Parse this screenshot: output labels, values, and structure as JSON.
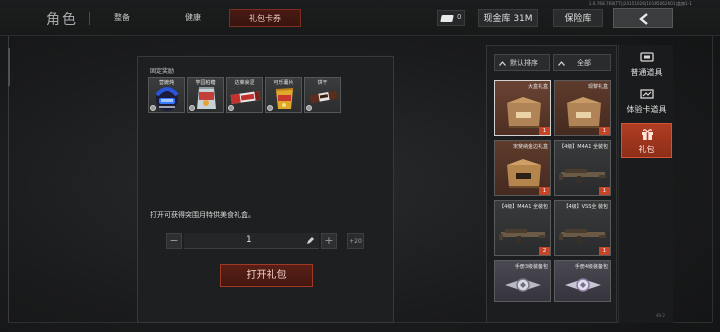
{
  "version": "1.0.768.768(TT)|20151026|10185062601|盖旗1-1",
  "page_title": "角色",
  "tabs": [
    {
      "label": "整备",
      "active": false
    },
    {
      "label": "健康",
      "active": false
    },
    {
      "label": "礼包卡券",
      "active": true
    }
  ],
  "header": {
    "ticket_count": "0",
    "cash_label": "现金库 31M",
    "warehouse_label": "保险库",
    "back_icon": "chevron-left-icon"
  },
  "center": {
    "fixed_rewards_label": "固定奖励",
    "rewards": [
      {
        "name": "营嬷炖",
        "icon": "helmet-icon"
      },
      {
        "name": "竽园柏糖",
        "icon": "candy-bag-icon"
      },
      {
        "name": "达莱哀涩",
        "icon": "candy-bar-icon"
      },
      {
        "name": "可乐薯片",
        "icon": "chips-bag-icon"
      },
      {
        "name": "饼干",
        "icon": "biscuit-icon"
      }
    ],
    "description": "打开可获得突围月特供美食礼盒。",
    "quantity": "1",
    "max_label": "+20",
    "open_button": "打开礼包"
  },
  "inventory": {
    "sort_label": "默认排序",
    "filter_label": "全部",
    "items": [
      {
        "name": "大盒礼盒",
        "count": "1",
        "style": "crate",
        "selected": true
      },
      {
        "name": "现黎礼盒",
        "count": "1",
        "style": "crate",
        "selected": false
      },
      {
        "name": "宋斐纳金边礼盒",
        "count": "1",
        "style": "crate",
        "selected": false
      },
      {
        "name": "【4级】M4A1 全装包",
        "count": "1",
        "style": "rifle",
        "selected": false
      },
      {
        "name": "【4级】M4A1 全装包",
        "count": "2",
        "style": "rifle",
        "selected": false
      },
      {
        "name": "【4级】VSS全 装包",
        "count": "1",
        "style": "rifle",
        "selected": false
      },
      {
        "name": "手册3级装备包",
        "count": "",
        "style": "badge",
        "selected": false
      },
      {
        "name": "手册4级装备包",
        "count": "",
        "style": "badge",
        "selected": false
      }
    ]
  },
  "categories": [
    {
      "label": "普通道具",
      "icon": "ticket-icon",
      "active": false
    },
    {
      "label": "体验卡道具",
      "icon": "card-icon",
      "active": false
    },
    {
      "label": "礼包",
      "icon": "gift-icon",
      "active": true
    }
  ],
  "rail_footer": "40·2"
}
